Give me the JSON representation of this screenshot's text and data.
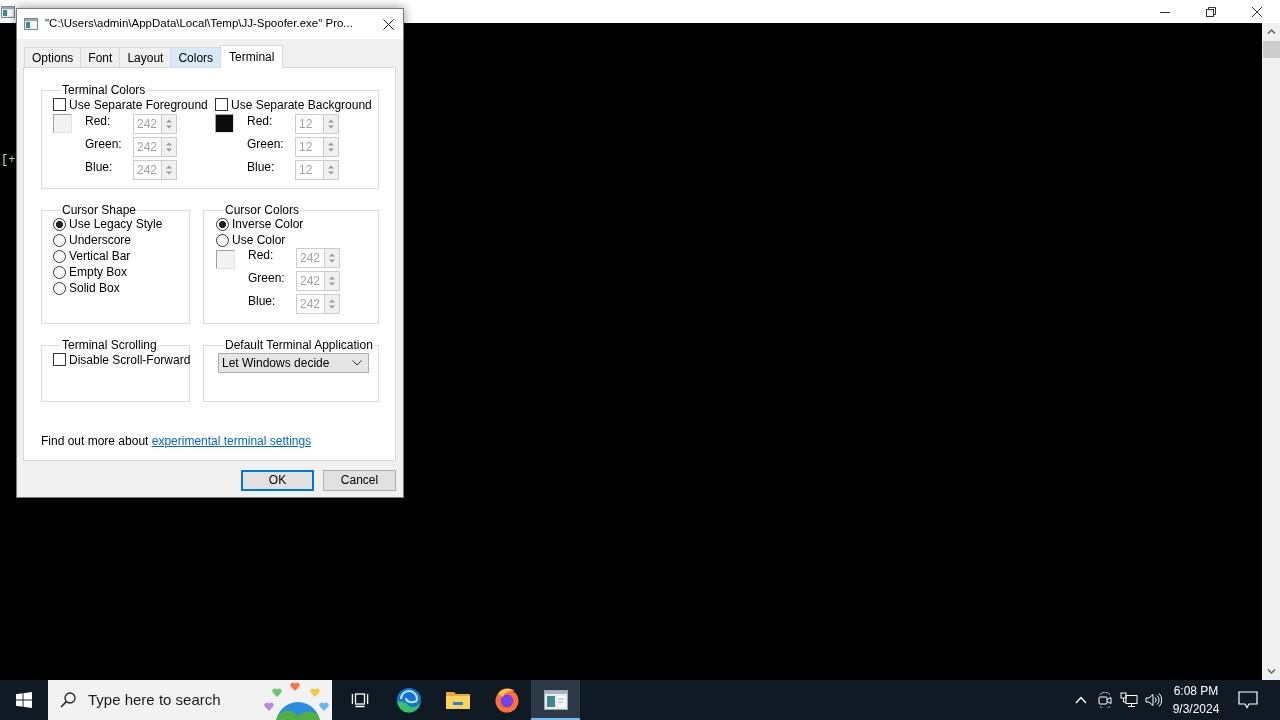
{
  "console": {
    "lines": [
      "[+"
    ]
  },
  "dialog": {
    "title": "\"C:\\Users\\admin\\AppData\\Local\\Temp\\JJ-Spoofer.exe\" Pro...",
    "tabs": [
      {
        "label": "Options",
        "selected": false,
        "hovered": false
      },
      {
        "label": "Font",
        "selected": false,
        "hovered": false
      },
      {
        "label": "Layout",
        "selected": false,
        "hovered": false
      },
      {
        "label": "Colors",
        "selected": false,
        "hovered": true
      },
      {
        "label": "Terminal",
        "selected": true,
        "hovered": false
      }
    ],
    "terminal_colors": {
      "title": "Terminal Colors",
      "groups": [
        {
          "checkbox": {
            "label": "Use Separate Foreground",
            "checked": false
          },
          "color": "#f2f2f2",
          "channels": [
            {
              "label": "Red:",
              "value": "242",
              "disabled": true
            },
            {
              "label": "Green:",
              "value": "242",
              "disabled": true
            },
            {
              "label": "Blue:",
              "value": "242",
              "disabled": true
            }
          ]
        },
        {
          "checkbox": {
            "label": "Use Separate Background",
            "checked": false
          },
          "color": "#0c0c0c",
          "channels": [
            {
              "label": "Red:",
              "value": "12",
              "disabled": true
            },
            {
              "label": "Green:",
              "value": "12",
              "disabled": true
            },
            {
              "label": "Blue:",
              "value": "12",
              "disabled": true
            }
          ]
        }
      ]
    },
    "cursor_shape": {
      "title": "Cursor Shape",
      "options": [
        {
          "label": "Use Legacy Style",
          "selected": true
        },
        {
          "label": "Underscore",
          "selected": false
        },
        {
          "label": "Vertical Bar",
          "selected": false
        },
        {
          "label": "Empty Box",
          "selected": false
        },
        {
          "label": "Solid Box",
          "selected": false
        }
      ]
    },
    "cursor_colors": {
      "title": "Cursor Colors",
      "options": [
        {
          "label": "Inverse Color",
          "selected": true
        },
        {
          "label": "Use Color",
          "selected": false
        }
      ],
      "color": "#f2f2f2",
      "channels": [
        {
          "label": "Red:",
          "value": "242",
          "disabled": true
        },
        {
          "label": "Green:",
          "value": "242",
          "disabled": true
        },
        {
          "label": "Blue:",
          "value": "242",
          "disabled": true
        }
      ]
    },
    "terminal_scrolling": {
      "title": "Terminal Scrolling",
      "checkbox": {
        "label": "Disable Scroll-Forward",
        "checked": false
      }
    },
    "default_terminal_application": {
      "title": "Default Terminal Application",
      "dropdown": {
        "value": "Let Windows decide"
      }
    },
    "info": {
      "text": "Find out more about",
      "link": "experimental terminal settings"
    },
    "buttons": [
      {
        "label": "OK",
        "default": true
      },
      {
        "label": "Cancel",
        "default": false
      }
    ]
  },
  "taskbar": {
    "search": {
      "placeholder": "Type here to search"
    },
    "apps": [
      {
        "kind": "taskview",
        "active": false
      },
      {
        "kind": "edge",
        "active": false
      },
      {
        "kind": "folder",
        "active": false
      },
      {
        "kind": "firefox",
        "active": false
      },
      {
        "kind": "console",
        "active": true
      }
    ],
    "clock": {
      "time": "6:08 PM",
      "date": "9/3/2024"
    }
  }
}
